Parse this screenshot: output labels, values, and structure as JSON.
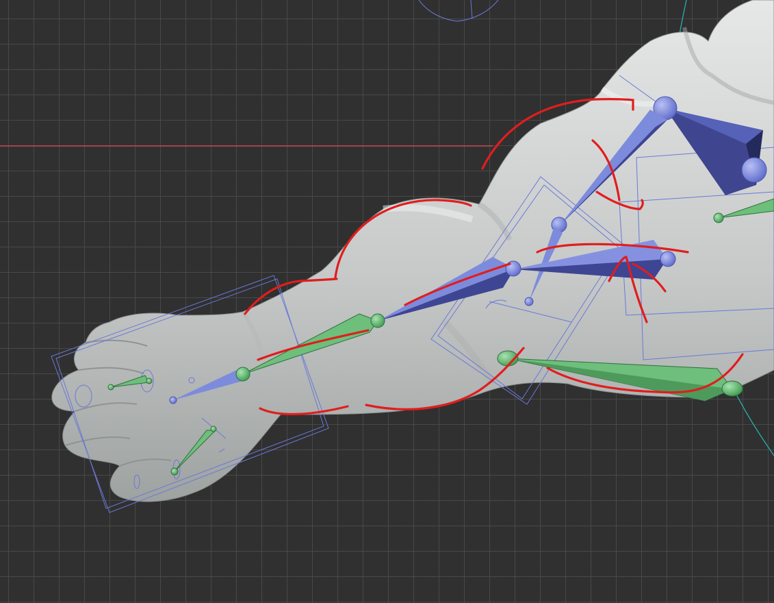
{
  "viewport": {
    "mode": "3d-viewport",
    "background_color": "#303030",
    "grid_color": "#4a4a4a",
    "x_axis_color": "#c4464f",
    "y_axis_color": "#2aa6a6"
  },
  "scene": {
    "mesh_color": "#cdd0cf",
    "deform_bone_color": "#7d8bdc",
    "deform_bone_dark": "#3e4593",
    "control_bone_color": "#6dbf7b",
    "wire_color": "#6b78d6",
    "annotation_color": "#e11d1d"
  }
}
